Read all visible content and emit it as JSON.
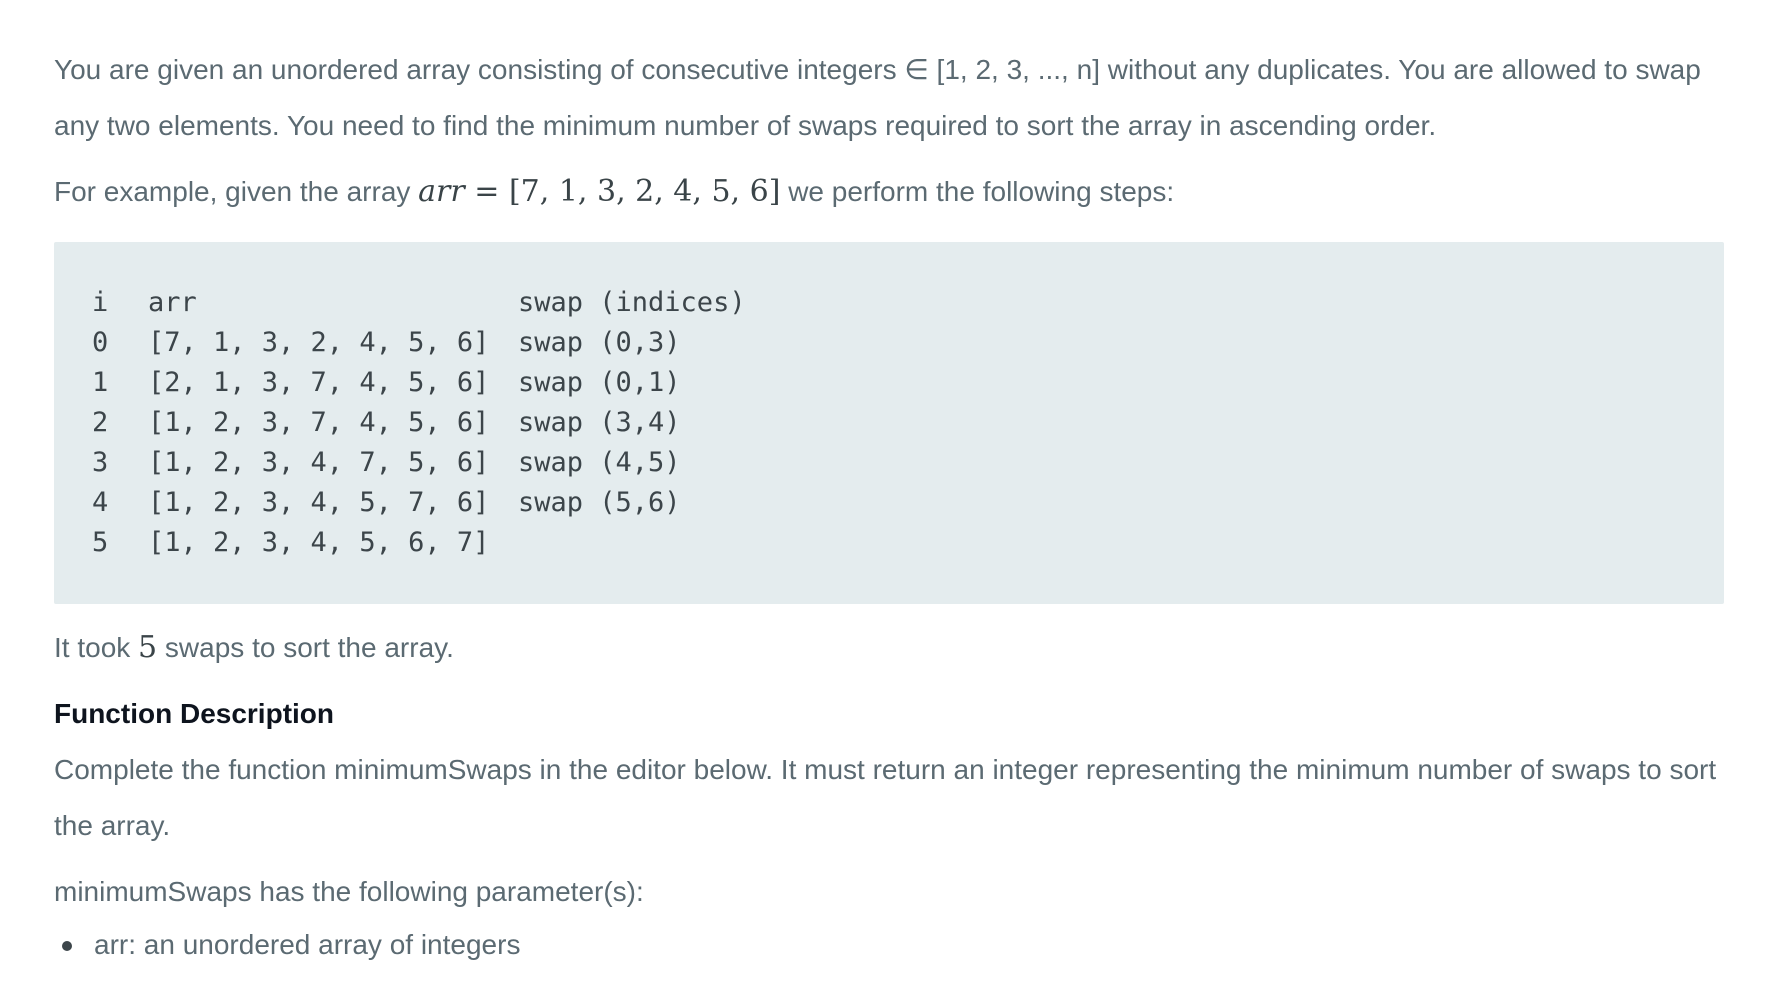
{
  "intro": {
    "line": "You are given an unordered array consisting of consecutive integers ∈ [1, 2, 3, ..., n] without any duplicates. You are allowed to swap any two elements. You need to find the minimum number of swaps required to sort the array in ascending order."
  },
  "example": {
    "before": "For example, given the array",
    "math_var": "arr",
    "math_eq": " = ",
    "math_value": "[7, 1, 3, 2, 4, 5, 6]",
    "after": " we perform the following steps:"
  },
  "code": {
    "headers": [
      "i",
      "arr",
      "swap (indices)"
    ],
    "rows": [
      [
        "0",
        "[7, 1, 3, 2, 4, 5, 6]",
        "swap (0,3)"
      ],
      [
        "1",
        "[2, 1, 3, 7, 4, 5, 6]",
        "swap (0,1)"
      ],
      [
        "2",
        "[1, 2, 3, 7, 4, 5, 6]",
        "swap (3,4)"
      ],
      [
        "3",
        "[1, 2, 3, 4, 7, 5, 6]",
        "swap (4,5)"
      ],
      [
        "4",
        "[1, 2, 3, 4, 5, 7, 6]",
        "swap (5,6)"
      ],
      [
        "5",
        "[1, 2, 3, 4, 5, 6, 7]",
        ""
      ]
    ]
  },
  "result": {
    "before": "It took ",
    "count": "5",
    "after": " swaps to sort the array."
  },
  "function_heading": "Function Description",
  "function_desc": "Complete the function minimumSwaps in the editor below. It must return an integer representing the minimum number of swaps to sort the array.",
  "params_intro": "minimumSwaps has the following parameter(s):",
  "params": [
    "arr: an unordered array of integers"
  ]
}
